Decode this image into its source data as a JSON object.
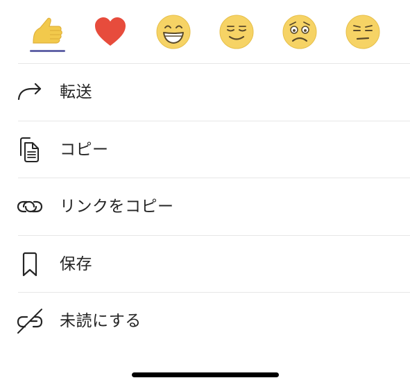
{
  "reactions": [
    {
      "name": "like",
      "icon": "thumbs-up-icon",
      "color": "#f2c94c",
      "selected": true
    },
    {
      "name": "heart",
      "icon": "heart-icon",
      "color": "#e74c3c",
      "selected": false
    },
    {
      "name": "laugh",
      "icon": "laughing-face-icon",
      "color": "#f6d365",
      "selected": false
    },
    {
      "name": "smile",
      "icon": "smiling-face-icon",
      "color": "#f6d365",
      "selected": false
    },
    {
      "name": "surprised",
      "icon": "surprised-face-icon",
      "color": "#f6d365",
      "selected": false
    },
    {
      "name": "annoyed",
      "icon": "annoyed-face-icon",
      "color": "#f6d365",
      "selected": false
    }
  ],
  "menu": {
    "items": [
      {
        "label": "転送",
        "icon": "forward-arrow-icon"
      },
      {
        "label": "コピー",
        "icon": "copy-document-icon"
      },
      {
        "label": "リンクをコピー",
        "icon": "link-icon"
      },
      {
        "label": "保存",
        "icon": "bookmark-icon"
      },
      {
        "label": "未読にする",
        "icon": "unread-icon"
      }
    ]
  },
  "colors": {
    "accent": "#6264a7",
    "text": "#242424",
    "divider": "#e6e6e6"
  }
}
